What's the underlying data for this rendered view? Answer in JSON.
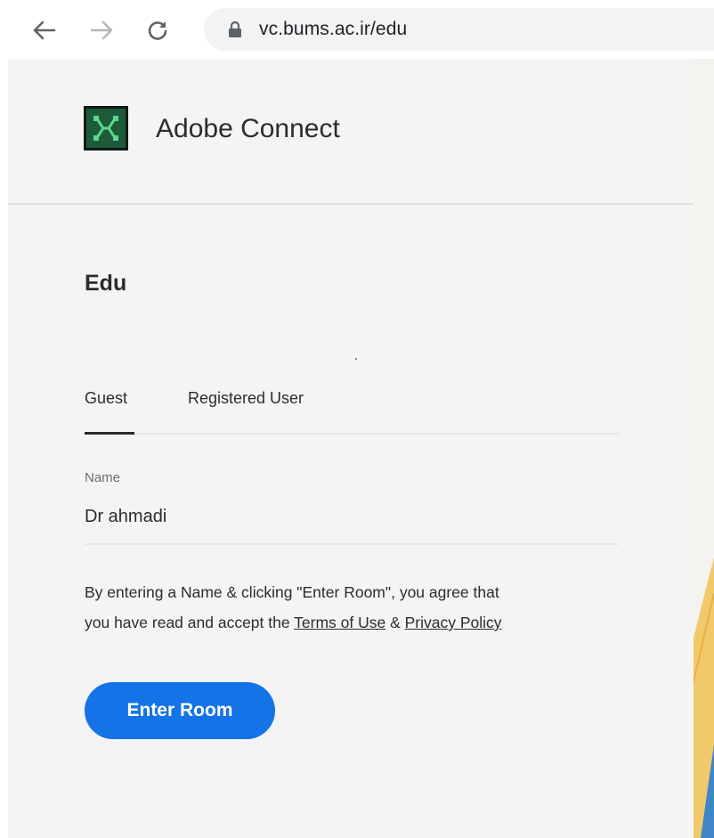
{
  "browser": {
    "url": "vc.bums.ac.ir/edu",
    "icons": {
      "back": "arrow-left-icon",
      "forward": "arrow-right-icon",
      "reload": "reload-icon",
      "lock": "lock-icon"
    }
  },
  "header": {
    "brand_name": "Adobe Connect"
  },
  "room": {
    "title": "Edu"
  },
  "tabs": [
    {
      "label": "Guest",
      "active": true
    },
    {
      "label": "Registered User",
      "active": false
    }
  ],
  "form": {
    "name_label": "Name",
    "name_value": "Dr ahmadi",
    "terms_line1": "By entering a Name & clicking \"Enter Room\", you agree that",
    "terms_line2_prefix": "you have read and accept the ",
    "terms_link": "Terms of Use",
    "terms_and": " & ",
    "privacy_link": "Privacy Policy",
    "enter_button": "Enter Room"
  },
  "colors": {
    "accent": "#1473e6",
    "panel_bg": "#f4f4f4",
    "logo_bg": "#1c5a3a",
    "logo_mark": "#5bd88a"
  }
}
